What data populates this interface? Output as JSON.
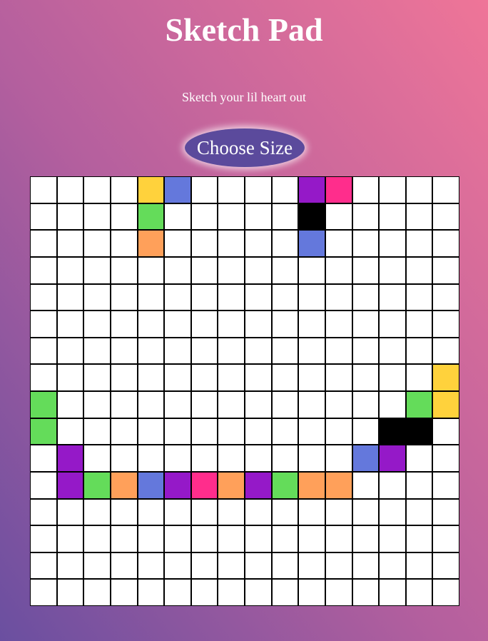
{
  "header": {
    "title": "Sketch Pad",
    "subtitle": "Sketch your lil heart out"
  },
  "controls": {
    "choose_size_label": "Choose Size"
  },
  "palette": {
    "Y": "#ffd23c",
    "B": "#6478dc",
    "P": "#9519c8",
    "K": "#ff2d8c",
    "G": "#64dc5a",
    "O": "#ffa05a",
    "N": "#000000",
    "W": "#ffffff"
  },
  "grid": {
    "size": 16,
    "rows": [
      "WWWWYBWWWWPKWWWW",
      "WWWWGWWWWWNWWWWW",
      "WWWWOWWWWWBWWWWW",
      "WWWWWWWWWWWWWWWW",
      "WWWWWWWWWWWWWWWW",
      "WWWWWWWWWWWWWWWW",
      "WWWWWWWWWWWWWWWW",
      "WWWWWWWWWWWWWWWY",
      "GWWWWWWWWWWWWWGY",
      "GWWWWWWWWWWWWNNW",
      "WPWWWWWWWWWWBPWW",
      "WPGOBPKOPGOOWWWW",
      "WWWWWWWWWWWWWWWW",
      "WWWWWWWWWWWWWWWW",
      "WWWWWWWWWWWWWWWW",
      "WWWWWWWWWWWWWWWW"
    ]
  }
}
